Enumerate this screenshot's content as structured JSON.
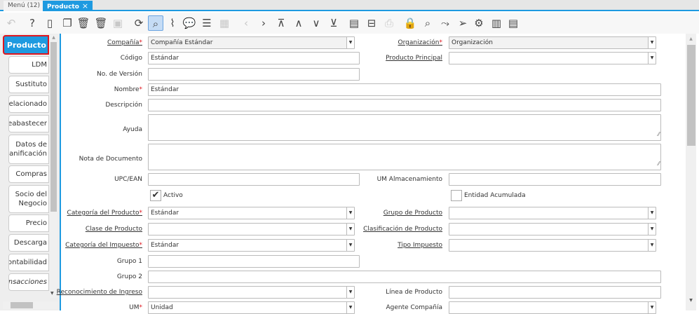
{
  "tabs": [
    {
      "label": "Menú (12)"
    },
    {
      "label": "Producto",
      "close": "×"
    }
  ],
  "toolbar": [
    "undo-icon",
    "help-icon",
    "new-record-icon",
    "copy-record-icon",
    "delete-icon",
    "delete-selection-icon",
    "save-icon",
    "refresh-icon",
    "find-icon",
    "attachment-icon",
    "chat-icon",
    "grid-toggle-icon",
    "calendar-icon",
    "previous-icon",
    "next-icon",
    "first-record-icon",
    "parent-record-icon",
    "detail-record-icon",
    "last-record-icon",
    "report-icon",
    "archive-icon",
    "print-icon",
    "lock-icon",
    "zoom-across-icon",
    "workflow-icon",
    "send-icon",
    "process-icon",
    "product-info-icon",
    "quick-form-icon"
  ],
  "sidebar": [
    "Producto",
    "LDM",
    "Sustituto",
    "Relacionado",
    "Reabastecer",
    "Datos de\nPlanificación",
    "Compras",
    "Socio del\nNegocio",
    "Precio",
    "Descarga",
    "Contabilidad",
    "Transacciones"
  ],
  "fields": [
    {
      "label": "Compañía",
      "required": true,
      "link": true,
      "value": "Compañía Estándar",
      "type": "combo",
      "readonly": true
    },
    {
      "label": "Organización",
      "required": true,
      "link": true,
      "value": "Organización",
      "type": "combo",
      "readonly": true
    },
    {
      "label": "Código",
      "value": "Estándar",
      "type": "text"
    },
    {
      "label": "Producto Principal",
      "link": true,
      "value": "",
      "type": "combo"
    },
    {
      "label": "No. de Versión",
      "value": "",
      "type": "text"
    },
    {
      "label": "Nombre",
      "required": true,
      "value": "Estándar",
      "type": "text"
    },
    {
      "label": "Descripción",
      "value": "",
      "type": "text"
    },
    {
      "label": "Ayuda",
      "value": "",
      "type": "textarea"
    },
    {
      "label": "Nota de Documento",
      "value": "",
      "type": "textarea"
    },
    {
      "label": "UPC/EAN",
      "value": "",
      "type": "text"
    },
    {
      "label": "UM Almacenamiento",
      "value": "",
      "type": "text"
    },
    {
      "label": "Activo",
      "checked": true,
      "type": "check"
    },
    {
      "label": "Entidad Acumulada",
      "checked": false,
      "type": "check"
    },
    {
      "label": "Categoría del Producto",
      "required": true,
      "link": true,
      "value": "Estándar",
      "type": "combo"
    },
    {
      "label": "Grupo de Producto",
      "link": true,
      "value": "",
      "type": "combo"
    },
    {
      "label": "Clase de Producto",
      "link": true,
      "value": "",
      "type": "combo"
    },
    {
      "label": "Clasificación de Producto",
      "link": true,
      "value": "",
      "type": "combo"
    },
    {
      "label": "Categoría del Impuesto",
      "required": true,
      "link": true,
      "value": "Estándar",
      "type": "combo"
    },
    {
      "label": "Tipo Impuesto",
      "link": true,
      "value": "",
      "type": "combo"
    },
    {
      "label": "Grupo 1",
      "value": "",
      "type": "text"
    },
    {
      "label": "Grupo 2",
      "value": "",
      "type": "text"
    },
    {
      "label": "Reconocimiento de Ingreso",
      "link": true,
      "value": "",
      "type": "combo"
    },
    {
      "label": "Línea de Producto",
      "value": "",
      "type": "text"
    },
    {
      "label": "UM",
      "required": true,
      "value": "Unidad",
      "type": "combo"
    },
    {
      "label": "Agente Compañía",
      "value": "",
      "type": "combo"
    }
  ],
  "colors": {
    "accent": "#1e9ae0",
    "required": "#e0161e",
    "selected_outline": "#e0161e"
  }
}
